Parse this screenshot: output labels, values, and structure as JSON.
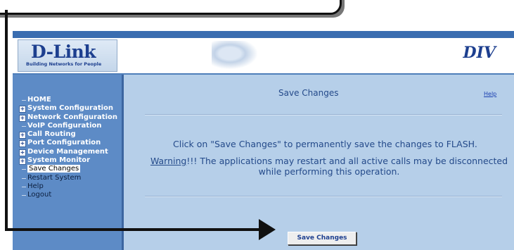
{
  "header": {
    "logo_text": "D-Link",
    "logo_tagline": "Building Networks for People",
    "product": "DIV"
  },
  "sidebar": {
    "items": [
      {
        "label": "HOME",
        "style": "bold",
        "expandable": false
      },
      {
        "label": "System Configuration",
        "style": "bold",
        "expandable": true
      },
      {
        "label": "Network Configuration",
        "style": "bold",
        "expandable": true
      },
      {
        "label": "VoIP Configuration",
        "style": "bold",
        "expandable": false
      },
      {
        "label": "Call Routing",
        "style": "bold",
        "expandable": true
      },
      {
        "label": "Port Configuration",
        "style": "bold",
        "expandable": true
      },
      {
        "label": "Device Management",
        "style": "bold",
        "expandable": true
      },
      {
        "label": "System Monitor",
        "style": "bold",
        "expandable": true
      },
      {
        "label": "Save Changes",
        "style": "sub",
        "active": true
      },
      {
        "label": "Restart System",
        "style": "sub"
      },
      {
        "label": "Help",
        "style": "sub"
      },
      {
        "label": "Logout",
        "style": "sub"
      }
    ]
  },
  "main": {
    "title": "Save Changes",
    "help_link": "Help",
    "message": "Click on \"Save Changes\" to permanently save the changes to FLASH.",
    "warning_word": "Warning",
    "warning_text": "!!! The applications may restart and all active calls may be disconnected while performing  this operation.",
    "save_button": "Save Changes"
  }
}
